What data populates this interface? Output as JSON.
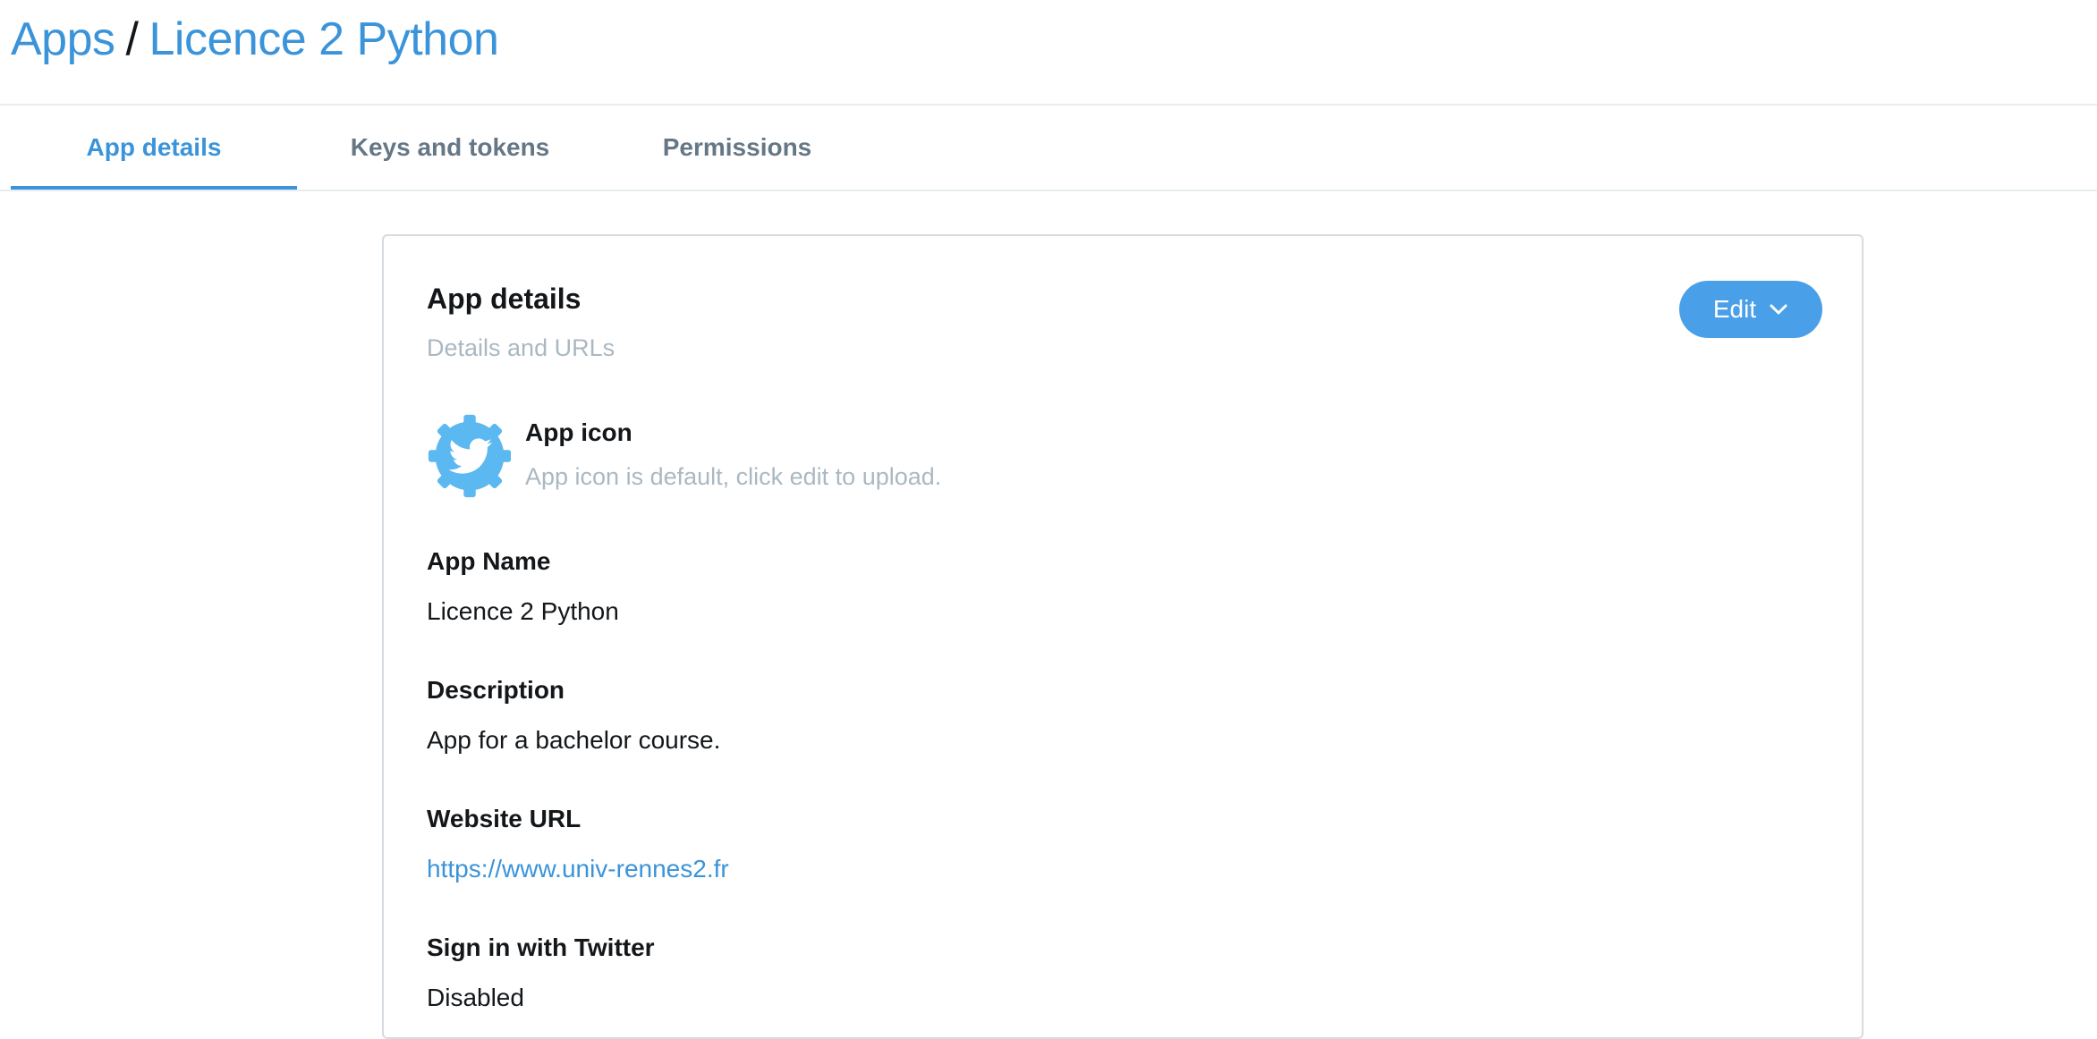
{
  "breadcrumb": {
    "root": "Apps",
    "separator": "/",
    "current": "Licence 2 Python"
  },
  "tabs": [
    {
      "label": "App details",
      "active": true
    },
    {
      "label": "Keys and tokens",
      "active": false
    },
    {
      "label": "Permissions",
      "active": false
    }
  ],
  "card": {
    "title": "App details",
    "subtitle": "Details and URLs",
    "edit_label": "Edit",
    "app_icon": {
      "icon": "twitter-gear-icon",
      "title": "App icon",
      "description": "App icon is default, click edit to upload."
    },
    "fields": [
      {
        "label": "App Name",
        "value": "Licence 2 Python"
      },
      {
        "label": "Description",
        "value": "App for a bachelor course."
      },
      {
        "label": "Website URL",
        "value": "https://www.univ-rennes2.fr"
      },
      {
        "label": "Sign in with Twitter",
        "value": "Disabled"
      }
    ]
  },
  "colors": {
    "accent": "#3b94d9",
    "button": "#4aa0e8",
    "muted_text": "#aab8c2",
    "tab_inactive": "#657786",
    "icon_blue": "#5cb8f0"
  }
}
